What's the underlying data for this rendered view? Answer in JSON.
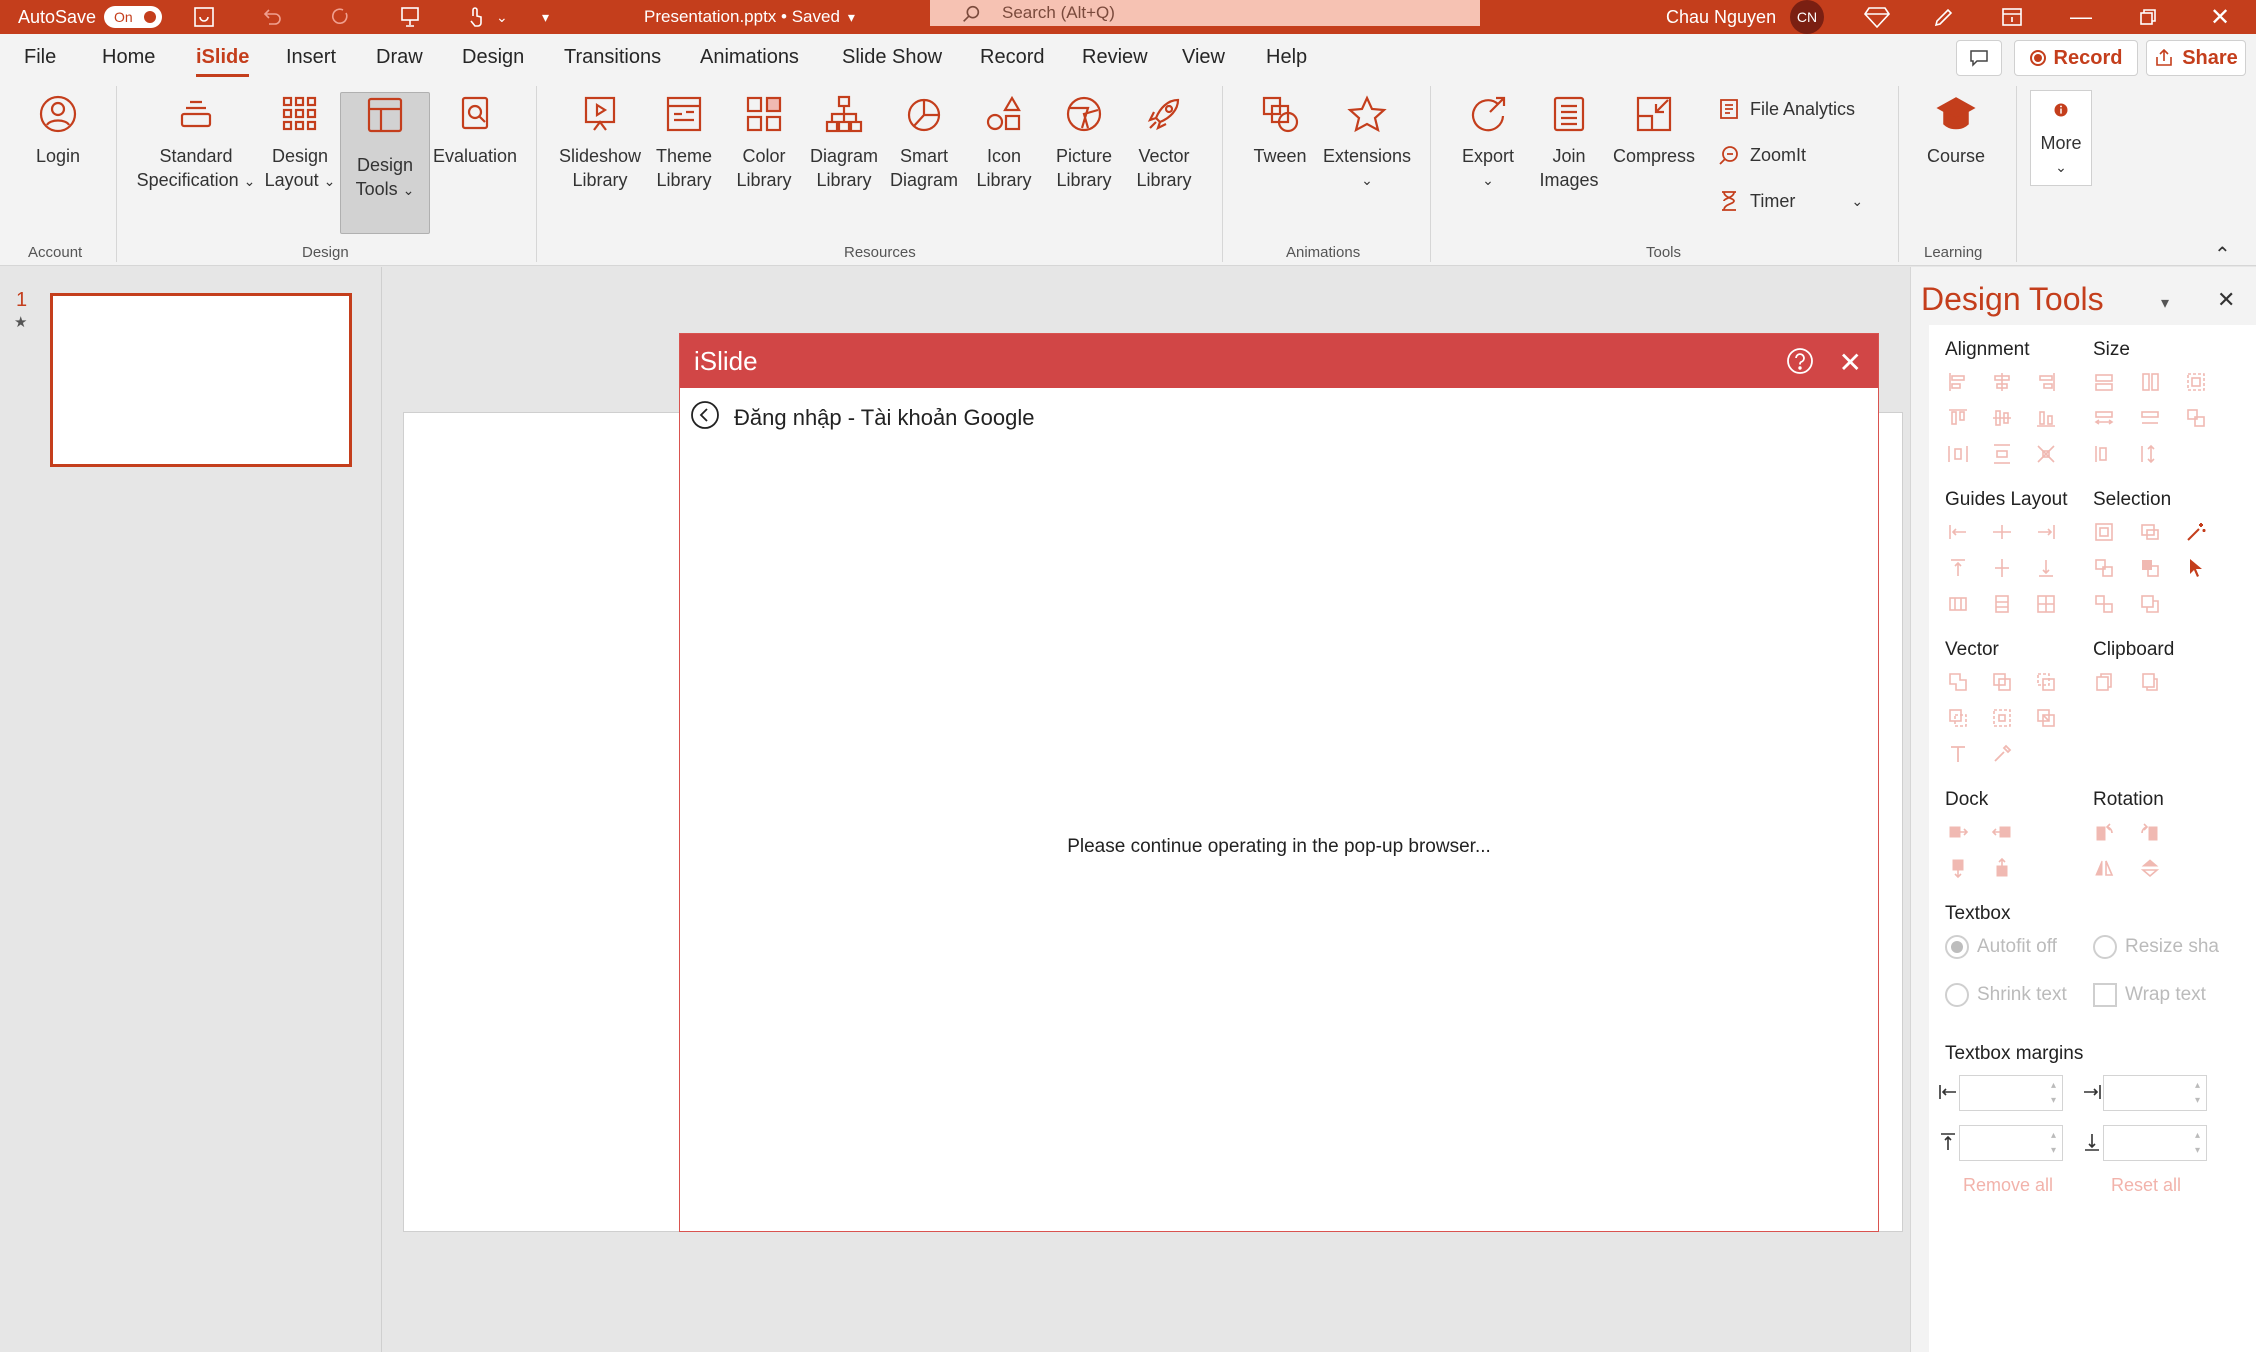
{
  "titlebar": {
    "autosave_label": "AutoSave",
    "autosave_state": "On",
    "doc_title": "Presentation.pptx • Saved",
    "search_placeholder": "Search (Alt+Q)",
    "user_name": "Chau Nguyen",
    "user_initials": "CN"
  },
  "tabs": [
    "File",
    "Home",
    "iSlide",
    "Insert",
    "Draw",
    "Design",
    "Transitions",
    "Animations",
    "Slide Show",
    "Record",
    "Review",
    "View",
    "Help"
  ],
  "active_tab": "iSlide",
  "top_buttons": {
    "record": "Record",
    "share": "Share"
  },
  "ribbon": {
    "login": "Login",
    "standard_spec": [
      "Standard",
      "Specification"
    ],
    "design_layout": [
      "Design",
      "Layout"
    ],
    "design_tools": [
      "Design",
      "Tools"
    ],
    "evaluation": "Evaluation",
    "slideshow_lib": [
      "Slideshow",
      "Library"
    ],
    "theme_lib": [
      "Theme",
      "Library"
    ],
    "color_lib": [
      "Color",
      "Library"
    ],
    "diagram_lib": [
      "Diagram",
      "Library"
    ],
    "smart_diagram": [
      "Smart",
      "Diagram"
    ],
    "icon_lib": [
      "Icon",
      "Library"
    ],
    "picture_lib": [
      "Picture",
      "Library"
    ],
    "vector_lib": [
      "Vector",
      "Library"
    ],
    "tween": "Tween",
    "extensions": "Extensions",
    "export": "Export",
    "join_images": [
      "Join",
      "Images"
    ],
    "compress": "Compress",
    "file_analytics": "File Analytics",
    "zoomit": "ZoomIt",
    "timer": "Timer",
    "course": "Course",
    "more": "More",
    "groups": {
      "account": "Account",
      "design": "Design",
      "resources": "Resources",
      "animations": "Animations",
      "tools": "Tools",
      "learning": "Learning"
    }
  },
  "thumbnails": {
    "slide_number": "1",
    "star": "★"
  },
  "dialog": {
    "title": "iSlide",
    "subtitle": "Đăng nhập - Tài khoản Google",
    "message": "Please continue operating in the pop-up browser..."
  },
  "pane": {
    "title": "Design Tools",
    "sections": {
      "alignment": "Alignment",
      "size": "Size",
      "guides_layout": "Guides Layout",
      "selection": "Selection",
      "vector": "Vector",
      "clipboard": "Clipboard",
      "dock": "Dock",
      "rotation": "Rotation",
      "textbox": "Textbox",
      "textbox_margins": "Textbox margins"
    },
    "textbox_options": {
      "autofit_off": "Autofit off",
      "resize_shape": "Resize sha",
      "shrink_text": "Shrink text",
      "wrap_text": "Wrap text"
    },
    "remove_all": "Remove all",
    "reset_all": "Reset all"
  },
  "colors": {
    "accent": "#c43e1c",
    "dialog_header": "#d14646"
  }
}
